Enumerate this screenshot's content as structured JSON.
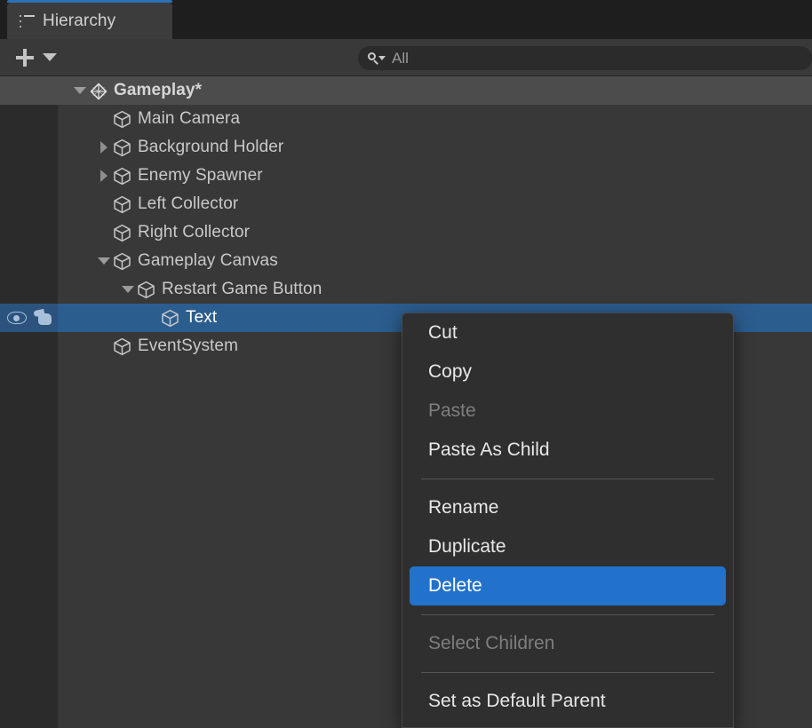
{
  "window": {
    "tab_label": "Hierarchy",
    "tab_icon": "list-icon",
    "accent_color": "#2c6fb5"
  },
  "toolbar": {
    "add_icon": "plus-icon",
    "add_dropdown_icon": "chevron-down-icon",
    "search": {
      "icon": "search-icon",
      "placeholder": "All",
      "value": ""
    }
  },
  "hierarchy": {
    "rows": [
      {
        "label": "Gameplay*",
        "indent": 0,
        "foldout": "open",
        "icon": "unity-scene-icon",
        "type": "scene",
        "selected": false
      },
      {
        "label": "Main Camera",
        "indent": 1,
        "foldout": "none",
        "icon": "gameobject-icon",
        "type": "object",
        "selected": false
      },
      {
        "label": "Background Holder",
        "indent": 1,
        "foldout": "closed",
        "icon": "gameobject-icon",
        "type": "object",
        "selected": false
      },
      {
        "label": "Enemy Spawner",
        "indent": 1,
        "foldout": "closed",
        "icon": "gameobject-icon",
        "type": "object",
        "selected": false
      },
      {
        "label": "Left Collector",
        "indent": 1,
        "foldout": "none",
        "icon": "gameobject-icon",
        "type": "object",
        "selected": false
      },
      {
        "label": "Right Collector",
        "indent": 1,
        "foldout": "none",
        "icon": "gameobject-icon",
        "type": "object",
        "selected": false
      },
      {
        "label": "Gameplay Canvas",
        "indent": 1,
        "foldout": "open",
        "icon": "gameobject-icon",
        "type": "object",
        "selected": false
      },
      {
        "label": "Restart Game Button",
        "indent": 2,
        "foldout": "open",
        "icon": "gameobject-icon",
        "type": "object",
        "selected": false
      },
      {
        "label": "Text",
        "indent": 3,
        "foldout": "none",
        "icon": "gameobject-icon",
        "type": "object",
        "selected": true
      },
      {
        "label": "EventSystem",
        "indent": 1,
        "foldout": "none",
        "icon": "gameobject-icon",
        "type": "object",
        "selected": false
      }
    ],
    "selected_row_toggles": {
      "visibility_icon": "eye-icon",
      "pickability_icon": "pointing-hand-icon"
    },
    "selection_color": "#2c5d8f"
  },
  "context_menu": {
    "highlight_color": "#2272cc",
    "items": [
      {
        "label": "Cut",
        "kind": "item",
        "state": "enabled"
      },
      {
        "label": "Copy",
        "kind": "item",
        "state": "enabled"
      },
      {
        "label": "Paste",
        "kind": "item",
        "state": "disabled"
      },
      {
        "label": "Paste As Child",
        "kind": "item",
        "state": "enabled"
      },
      {
        "label": "",
        "kind": "separator",
        "state": ""
      },
      {
        "label": "Rename",
        "kind": "item",
        "state": "enabled"
      },
      {
        "label": "Duplicate",
        "kind": "item",
        "state": "enabled"
      },
      {
        "label": "Delete",
        "kind": "item",
        "state": "highlight"
      },
      {
        "label": "",
        "kind": "separator",
        "state": ""
      },
      {
        "label": "Select Children",
        "kind": "item",
        "state": "disabled"
      },
      {
        "label": "",
        "kind": "separator",
        "state": ""
      },
      {
        "label": "Set as Default Parent",
        "kind": "item",
        "state": "enabled"
      }
    ]
  }
}
